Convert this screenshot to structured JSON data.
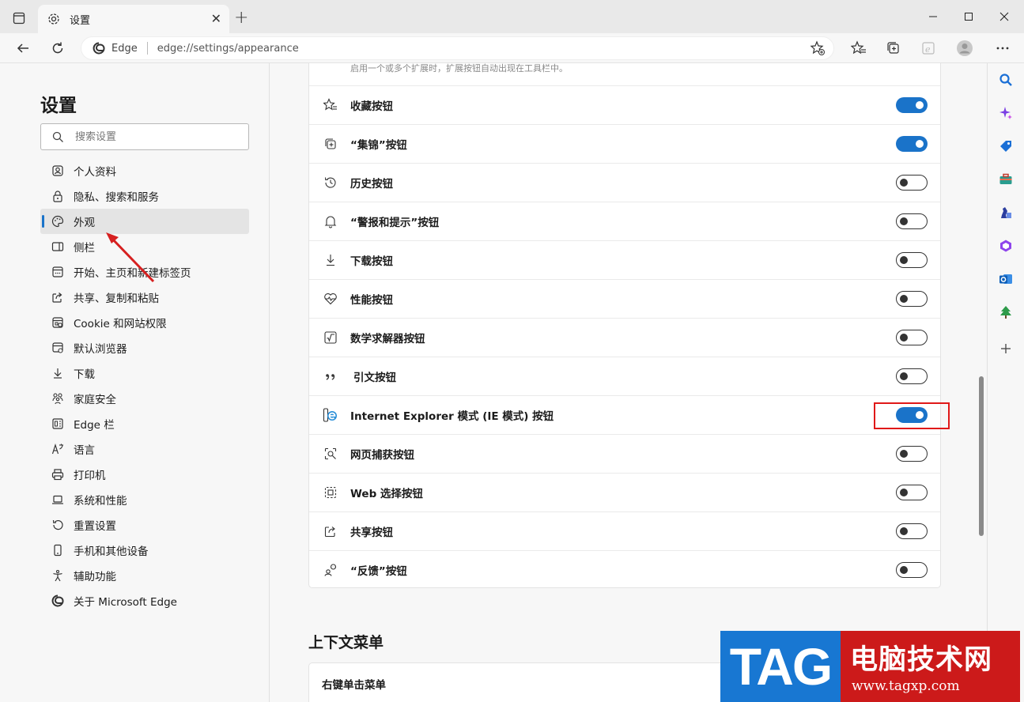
{
  "window": {
    "tab_title": "设置",
    "tab_close": "✕",
    "new_tab": "+",
    "minimize": "—",
    "maximize": "☐",
    "close": "✕"
  },
  "toolbar": {
    "site_name": "Edge",
    "url": "edge://settings/appearance"
  },
  "sidebar": {
    "title": "设置",
    "search_placeholder": "搜索设置",
    "items": [
      {
        "label": "个人资料",
        "icon": "profile-icon"
      },
      {
        "label": "隐私、搜索和服务",
        "icon": "lock-icon"
      },
      {
        "label": "外观",
        "icon": "palette-icon",
        "active": true
      },
      {
        "label": "侧栏",
        "icon": "sidebar-icon"
      },
      {
        "label": "开始、主页和新建标签页",
        "icon": "home-icon"
      },
      {
        "label": "共享、复制和粘贴",
        "icon": "share-icon"
      },
      {
        "label": "Cookie 和网站权限",
        "icon": "cookie-icon"
      },
      {
        "label": "默认浏览器",
        "icon": "browser-icon"
      },
      {
        "label": "下载",
        "icon": "download-icon"
      },
      {
        "label": "家庭安全",
        "icon": "family-icon"
      },
      {
        "label": "Edge 栏",
        "icon": "edge-bar-icon"
      },
      {
        "label": "语言",
        "icon": "language-icon"
      },
      {
        "label": "打印机",
        "icon": "printer-icon"
      },
      {
        "label": "系统和性能",
        "icon": "laptop-icon"
      },
      {
        "label": "重置设置",
        "icon": "reset-icon"
      },
      {
        "label": "手机和其他设备",
        "icon": "phone-icon"
      },
      {
        "label": "辅助功能",
        "icon": "accessibility-icon"
      },
      {
        "label": "关于 Microsoft Edge",
        "icon": "edge-logo-icon"
      }
    ]
  },
  "main": {
    "card_note": "启用一个或多个扩展时，扩展按钮自动出现在工具栏中。",
    "rows": [
      {
        "label": "收藏按钮",
        "on": true
      },
      {
        "label": "“集锦”按钮",
        "on": true
      },
      {
        "label": "历史按钮",
        "on": false
      },
      {
        "label": "“警报和提示”按钮",
        "on": false
      },
      {
        "label": "下载按钮",
        "on": false
      },
      {
        "label": "性能按钮",
        "on": false
      },
      {
        "label": "数学求解器按钮",
        "on": false
      },
      {
        "label": "引文按钮",
        "on": false
      },
      {
        "label": "Internet Explorer 模式 (IE 模式) 按钮",
        "on": true
      },
      {
        "label": "网页捕获按钮",
        "on": false
      },
      {
        "label": "Web 选择按钮",
        "on": false
      },
      {
        "label": "共享按钮",
        "on": false
      },
      {
        "label": "“反馈”按钮",
        "on": false
      }
    ],
    "section_title": "上下文菜单",
    "context_row": "右键单击菜单"
  },
  "watermark": {
    "tag": "TAG",
    "cn": "电脑技术网",
    "url": "www.tagxp.com"
  },
  "colors": {
    "accent": "#1a73c9",
    "highlight": "#e01818"
  }
}
